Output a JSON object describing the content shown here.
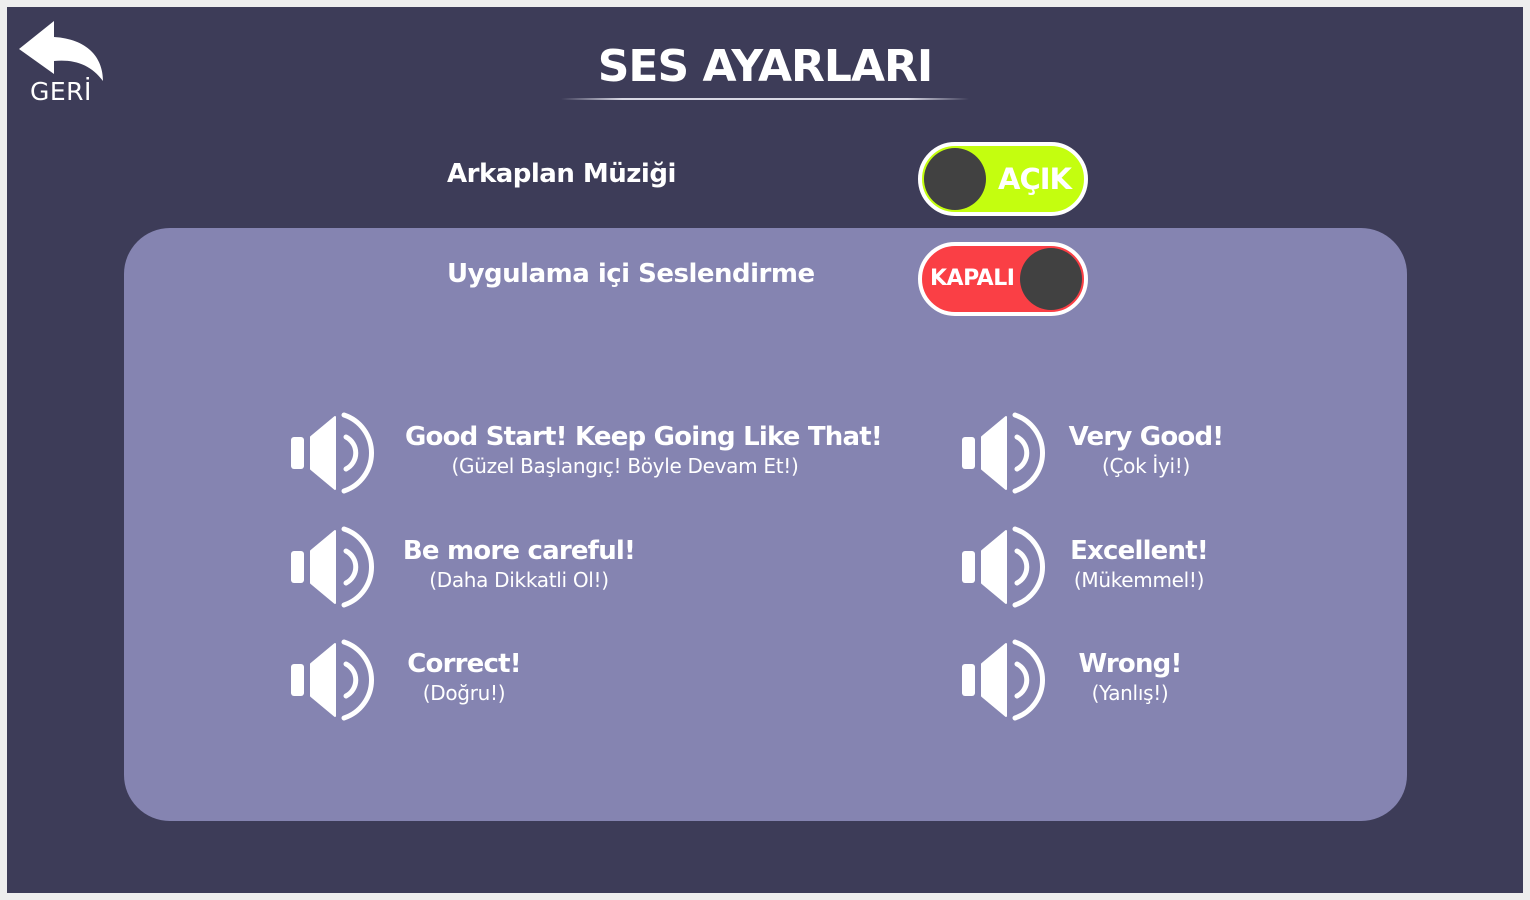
{
  "header": {
    "back_label": "GERİ",
    "title": "SES AYARLARI"
  },
  "settings": {
    "background_music": {
      "label": "Arkaplan Müziği",
      "state_label": "AÇIK",
      "enabled": true
    },
    "in_app_voice": {
      "label": "Uygulama içi Seslendirme",
      "state_label": "KAPALI",
      "enabled": false
    }
  },
  "sounds": [
    {
      "title": "Good Start! Keep Going Like That!",
      "subtitle": "(Güzel Başlangıç! Böyle Devam Et!)"
    },
    {
      "title": "Very Good!",
      "subtitle": "(Çok İyi!)"
    },
    {
      "title": "Be more careful!",
      "subtitle": "(Daha Dikkatli Ol!)"
    },
    {
      "title": "Excellent!",
      "subtitle": "(Mükemmel!)"
    },
    {
      "title": "Correct!",
      "subtitle": "(Doğru!)"
    },
    {
      "title": "Wrong!",
      "subtitle": "(Yanlış!)"
    }
  ],
  "colors": {
    "background": "#3d3c58",
    "panel": "#8584b1",
    "toggle_on": "#c4fe0f",
    "toggle_off": "#fa3f45",
    "knob": "#414141",
    "text": "#ffffff"
  },
  "icons": {
    "back": "back-arrow-icon",
    "speaker": "speaker-icon"
  }
}
